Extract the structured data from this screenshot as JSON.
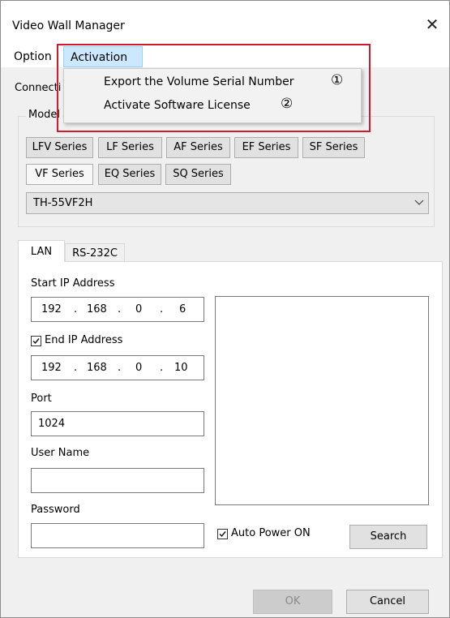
{
  "window": {
    "title": "Video Wall Manager",
    "close_glyph": "✕"
  },
  "menubar": {
    "items": [
      "Option",
      "Activation"
    ]
  },
  "activation_menu": {
    "items": [
      {
        "label": "Export the Volume Serial Number",
        "marker": "①"
      },
      {
        "label": "Activate Software License",
        "marker": "②"
      }
    ]
  },
  "connection_label": "Connecti",
  "model": {
    "legend": "Model",
    "series_row1": [
      "LFV Series",
      "LF Series",
      "AF Series",
      "EF Series",
      "SF Series"
    ],
    "series_row2": [
      "VF Series",
      "EQ Series",
      "SQ Series"
    ],
    "selected_series": "VF Series",
    "selected_model": "TH-55VF2H"
  },
  "tabs": [
    "LAN",
    "RS-232C"
  ],
  "lan": {
    "start_ip_label": "Start IP Address",
    "start_ip": [
      "192",
      "168",
      "0",
      "6"
    ],
    "end_ip_label": "End IP Address",
    "end_ip_checked": true,
    "end_ip": [
      "192",
      "168",
      "0",
      "10"
    ],
    "ip_separator": ".",
    "port_label": "Port",
    "port_value": "1024",
    "username_label": "User Name",
    "username_value": "",
    "password_label": "Password",
    "password_value": "",
    "auto_power_label": "Auto Power ON",
    "auto_power_checked": true,
    "search_label": "Search"
  },
  "footer": {
    "ok_label": "OK",
    "cancel_label": "Cancel"
  },
  "colors": {
    "highlight_box": "#d11a2a",
    "menu_hover": "#cce8ff"
  }
}
